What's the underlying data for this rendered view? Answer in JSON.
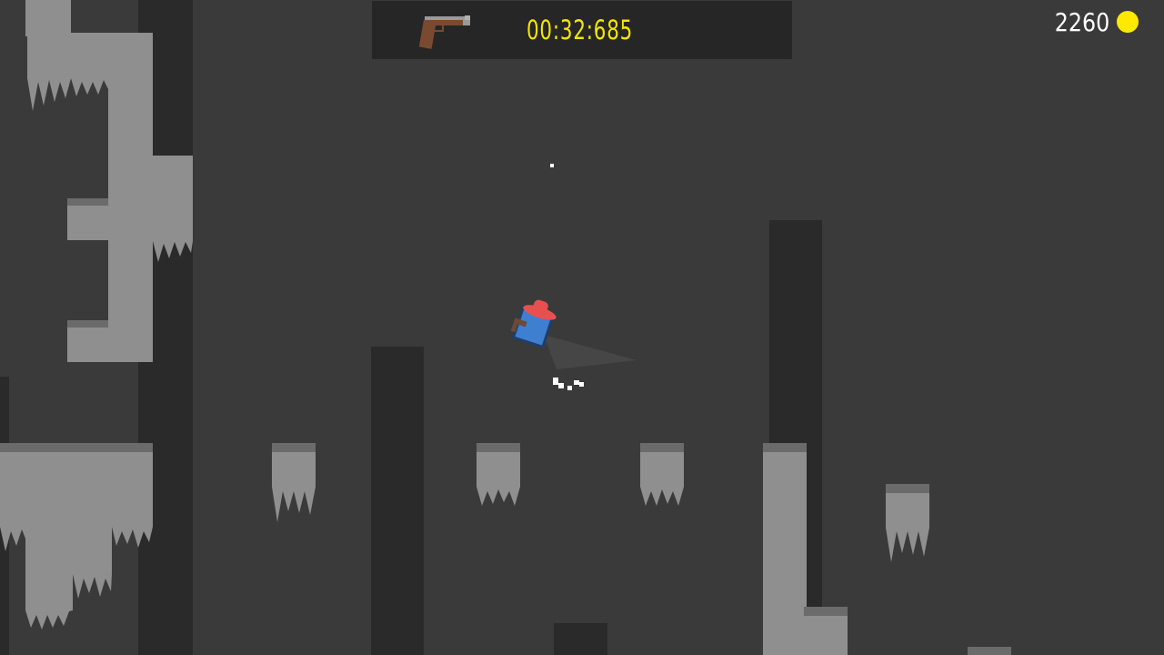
{
  "hud": {
    "timer": "00:32:685",
    "coins": "2260",
    "weapon": "pistol-icon",
    "timer_color": "#f2e600",
    "coin_color": "#ffe800"
  },
  "palette": {
    "background": "#3a3a3a",
    "dark_pillar": "#2a2a2a",
    "light_stone": "#8f8f8f",
    "player_body": "#3f7fd0",
    "player_hat": "#e85050"
  }
}
